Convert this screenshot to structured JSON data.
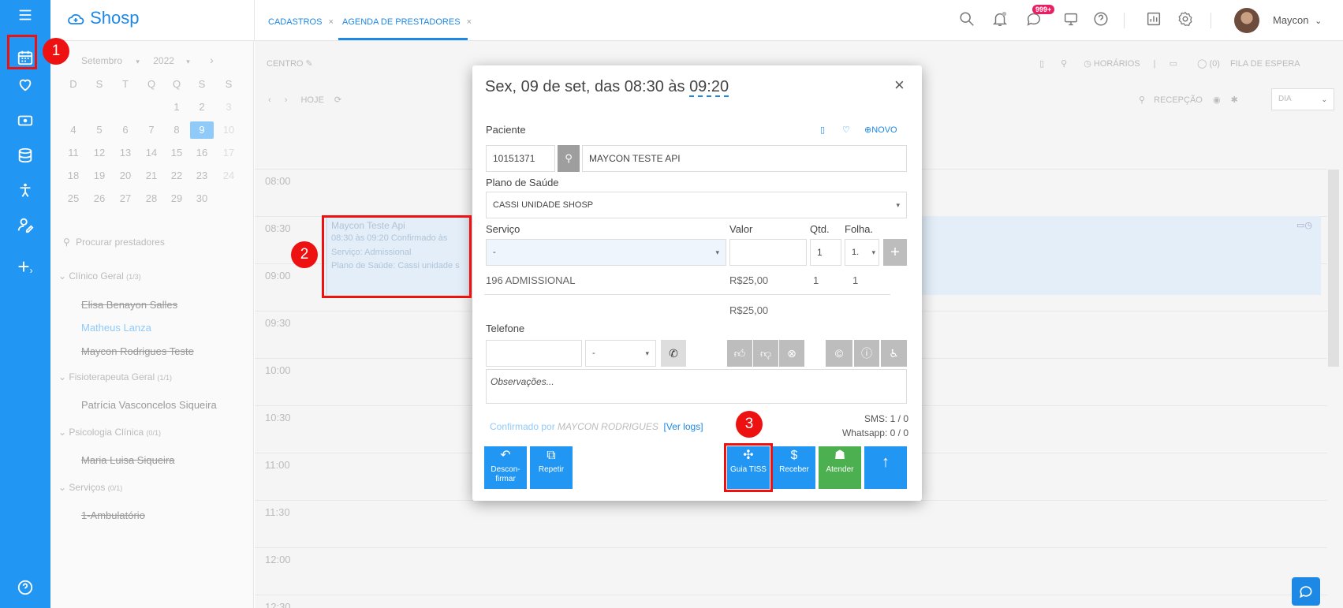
{
  "topbar": {
    "logo": "Shosp",
    "tabs": [
      {
        "label": "CADASTROS",
        "close": "×"
      },
      {
        "label": "AGENDA DE PRESTADORES",
        "close": "×"
      }
    ],
    "notification_badge": "999+",
    "user_name": "Maycon",
    "user_chevron": "⌄"
  },
  "calendar": {
    "month": "Setembro",
    "year": "2022",
    "weekdays": [
      "D",
      "S",
      "T",
      "Q",
      "Q",
      "S",
      "S"
    ],
    "selected_day": "9"
  },
  "left_panel": {
    "search_placeholder": "Procurar prestadores",
    "groups": [
      {
        "name": "Clínico Geral",
        "count": "(1/3)"
      },
      {
        "name": "Fisioterapeuta Geral",
        "count": "(1/1)"
      },
      {
        "name": "Psicologia Clínica",
        "count": "(0/1)"
      },
      {
        "name": "Serviços",
        "count": "(0/1)"
      }
    ],
    "providers": [
      "Elisa Benayon Salles",
      "Matheus Lanza",
      "Maycon Rodrigues Teste",
      "Patrícia Vasconcelos Siqueira",
      "Maria Luisa Siqueira",
      "1-Ambulatório"
    ]
  },
  "schedule": {
    "centro_label": "CENTRO",
    "hoje_label": "HOJE",
    "horarios_label": "HORÁRIOS",
    "espera_count": "(0)",
    "fila_label": "FILA DE ESPERA",
    "recepcao_label": "RECEPÇÃO",
    "view_label": "DIA",
    "times": [
      "08:00",
      "08:30",
      "09:00",
      "09:30",
      "10:00",
      "10:30",
      "11:00",
      "11:30",
      "12:00",
      "12:30"
    ],
    "appointment": {
      "title": "Maycon Teste Api",
      "line1": "08:30 às 09:20 Confirmado às",
      "line2": "Serviço: Admissional",
      "line3": "Plano de Saúde: Cassi unidade s"
    }
  },
  "modal": {
    "title_prefix": "Sex, 09 de set, das 08:30 às ",
    "title_end": "09:20",
    "close": "×",
    "paciente_label": "Paciente",
    "novo_label": "NOVO",
    "patient_id": "10151371",
    "patient_name": "MAYCON TESTE API",
    "plano_label": "Plano de Saúde",
    "plano_value": "CASSI UNIDADE SHOSP",
    "servico_label": "Serviço",
    "valor_label": "Valor",
    "qtd_label": "Qtd.",
    "folha_label": "Folha.",
    "servico_value": "-",
    "qtd_value": "1",
    "folha_value": "1.",
    "service_row": {
      "name": "196 ADMISSIONAL",
      "valor": "R$25,00",
      "qtd": "1",
      "folha": "1"
    },
    "total": "R$25,00",
    "telefone_label": "Telefone",
    "telefone_tipo": "-",
    "obs_placeholder": "Observações...",
    "confirm_prefix": "Confirmado por ",
    "confirm_who": "MAYCON RODRIGUES",
    "ver_logs": "[Ver logs]",
    "sms": "SMS: 1 / 0",
    "whatsapp": "Whatsapp: 0 / 0",
    "buttons": {
      "desconfirmar_1": "Descon-",
      "desconfirmar_2": "firmar",
      "repetir": "Repetir",
      "guia_tiss": "Guia TISS",
      "receber": "Receber",
      "atender": "Atender"
    }
  },
  "annotations": [
    "1",
    "2",
    "3"
  ],
  "colors": {
    "primary": "#2196f3",
    "highlight": "#ee1111",
    "success": "#4caf50"
  }
}
